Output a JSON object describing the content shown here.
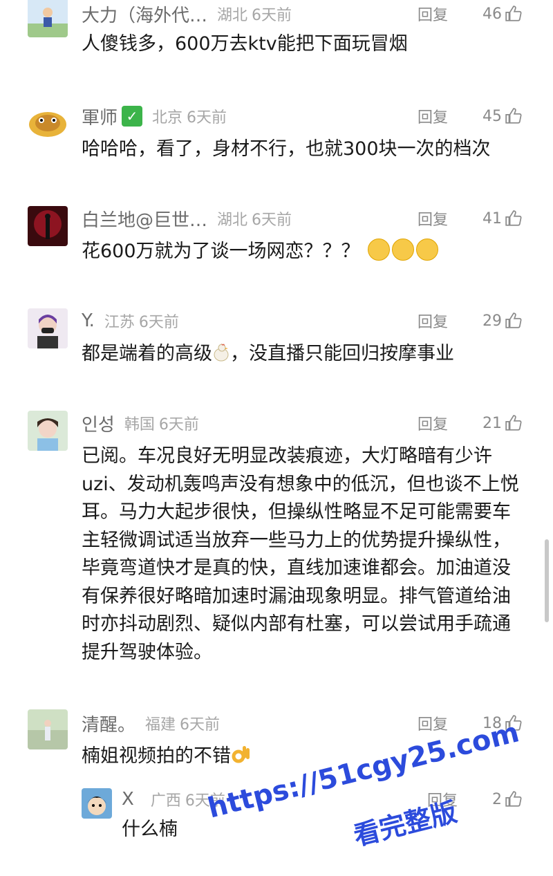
{
  "comments": [
    {
      "name": "大力（海外代…",
      "location": "湖北",
      "time": "6天前",
      "reply": "回复",
      "likes": "46",
      "text": "人傻钱多，600万去ktv能把下面玩冒烟"
    },
    {
      "name": "軍师",
      "location": "北京",
      "time": "6天前",
      "reply": "回复",
      "likes": "45",
      "text": "哈哈哈，看了，身材不行，也就300块一次的档次"
    },
    {
      "name": "白兰地@巨世…",
      "location": "湖北",
      "time": "6天前",
      "reply": "回复",
      "likes": "41",
      "text": "花600万就为了谈一场网恋？？？"
    },
    {
      "name": "Y.",
      "location": "江苏",
      "time": "6天前",
      "reply": "回复",
      "likes": "29",
      "text_a": "都是端着的高级",
      "text_b": "，没直播只能回归按摩事业"
    },
    {
      "name": "인성",
      "location": "韩国",
      "time": "6天前",
      "reply": "回复",
      "likes": "21",
      "text": "已阅。车况良好无明显改装痕迹，大灯略暗有少许uzi、发动机轰鸣声没有想象中的低沉，但也谈不上悦耳。马力大起步很快，但操纵性略显不足可能需要车主轻微调试适当放弃一些马力上的优势提升操纵性，毕竟弯道快才是真的快，直线加速谁都会。加油道没有保养很好略暗加速时漏油现象明显。排气管道给油时亦抖动剧烈、疑似内部有杜塞，可以尝试用手疏通提升驾驶体验。"
    },
    {
      "name": "清醒。",
      "location": "福建",
      "time": "6天前",
      "reply": "回复",
      "likes": "18",
      "text": "楠姐视频拍的不错"
    },
    {
      "name": "X",
      "location": "广西",
      "time": "6天前",
      "reply": "回复",
      "likes": "2",
      "text": "什么楠"
    }
  ],
  "watermark": {
    "line1": "https://51cgy25.com",
    "line2": "看完整版"
  }
}
